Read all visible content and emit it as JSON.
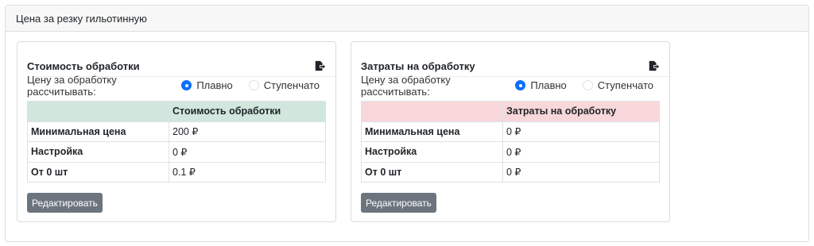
{
  "page": {
    "title": "Цена за резку гильотинную"
  },
  "cards": [
    {
      "title": "Стоимость обработки",
      "calc_label": "Цену за обработку рассчитывать:",
      "option_smooth": "Плавно",
      "option_step": "Ступенчато",
      "selected": "Плавно",
      "column_header": "Стоимость обработки",
      "rows": [
        {
          "label": "Минимальная цена",
          "value": "200 ₽"
        },
        {
          "label": "Настройка",
          "value": "0 ₽"
        },
        {
          "label": "От 0 шт",
          "value": "0.1 ₽"
        }
      ],
      "edit_label": "Редактировать",
      "header_color": "#d1e7dd"
    },
    {
      "title": "Затраты на обработку",
      "calc_label": "Цену за обработку рассчитывать:",
      "option_smooth": "Плавно",
      "option_step": "Ступенчато",
      "selected": "Плавно",
      "column_header": "Затраты на обработку",
      "rows": [
        {
          "label": "Минимальная цена",
          "value": "0 ₽"
        },
        {
          "label": "Настройка",
          "value": "0 ₽"
        },
        {
          "label": "От 0 шт",
          "value": "0 ₽"
        }
      ],
      "edit_label": "Редактировать",
      "header_color": "#f8d7da"
    }
  ],
  "icons": {
    "export": "file-export-icon"
  },
  "colors": {
    "radio_checked": "#0d6efd",
    "edit_button": "#6c757d"
  }
}
